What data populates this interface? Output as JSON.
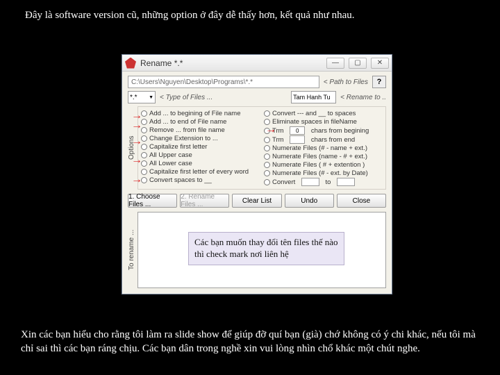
{
  "top_caption": "Đây là software version cũ, những option ở đây dễ thấy hơn, kết quả như nhau.",
  "bottom_caption": "Xin các bạn hiểu cho rằng tôi làm ra slide show để giúp đỡ quí bạn (già) chớ không có ý chi khác, nếu tôi mà chỉ sai thì các bạn ráng chịu. Các bạn dân trong nghề xin vui lòng nhìn chổ khác một chút nghe.",
  "window": {
    "title": "Rename *.*",
    "path_value": "C:\\Users\\Nguyen\\Desktop\\Programs\\*.*",
    "path_hint": "< Path to Files",
    "type_value": "*.*",
    "type_hint": "< Type of Files ...",
    "rename_value": "Tam Hanh Tu",
    "rename_hint": "< Rename to ..",
    "options_label": "Options",
    "torename_label": "To rename ...",
    "help": "?",
    "left_options": [
      "Add ... to begining of File name",
      "Add ... to end of File name",
      "Remove ... from file name",
      "Change Extension to ...",
      "Capitalize first letter",
      "All Upper case",
      "All Lower case",
      "Capitalize first letter of every word",
      "Convert spaces to __"
    ],
    "right_options": [
      "Convert --- and __ to spaces",
      "Eliminate spaces in fileName",
      "Trim ___ chars from begining",
      "Trim ___ chars from end",
      "Numerate Files (# - name + ext.)",
      "Numerate Files (name - # + ext.)",
      "Numerate Files ( # + extention )",
      "Numerate Files (# - ext. by Date)",
      "Convert ___ to ___"
    ],
    "trim_value": "0",
    "buttons": {
      "choose": "1. Choose Files ...",
      "rename": "2. Rename Files ...",
      "clear": "Clear List",
      "undo": "Undo",
      "close": "Close"
    }
  },
  "callout_text": "Các bạn muốn thay đổi tên files thế nào thì check mark nơi liên hệ",
  "arrow_glyph": "→"
}
